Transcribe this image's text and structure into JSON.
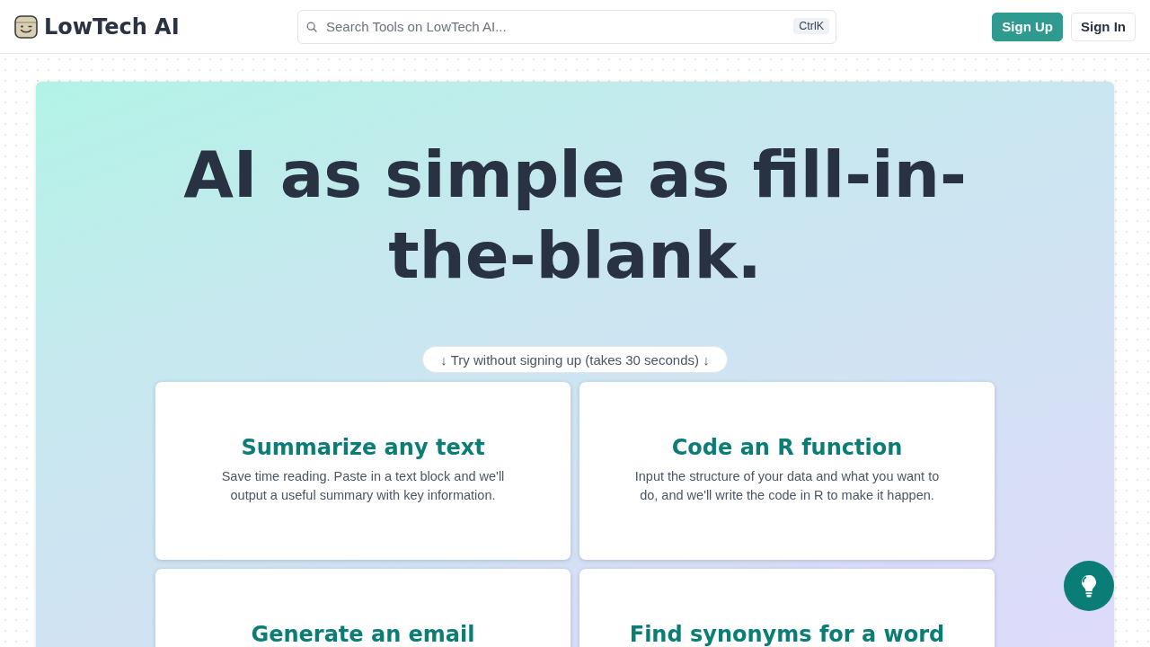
{
  "header": {
    "logo": {
      "title": "LowTech AI"
    },
    "search": {
      "placeholder": "Search Tools on LowTech AI...",
      "shortcut": "CtrlK"
    },
    "buttons": [
      {
        "label": "Sign Up",
        "kind": "primary"
      },
      {
        "label": "Sign In",
        "kind": "secondary"
      }
    ]
  },
  "hero": {
    "title": "AI as simple as fill-in-the-blank.",
    "try_pill": "↓ Try without signing up (takes 30 seconds) ↓",
    "tools": [
      {
        "title": "Summarize any text",
        "description": "Save time reading. Paste in a text block and we'll output a useful summary with key information."
      },
      {
        "title": "Code an R function",
        "description": "Input the structure of your data and what you want to do, and we'll write the code in R to make it happen."
      },
      {
        "title": "Generate an email"
      },
      {
        "title": "Find synonyms for a word"
      }
    ]
  }
}
